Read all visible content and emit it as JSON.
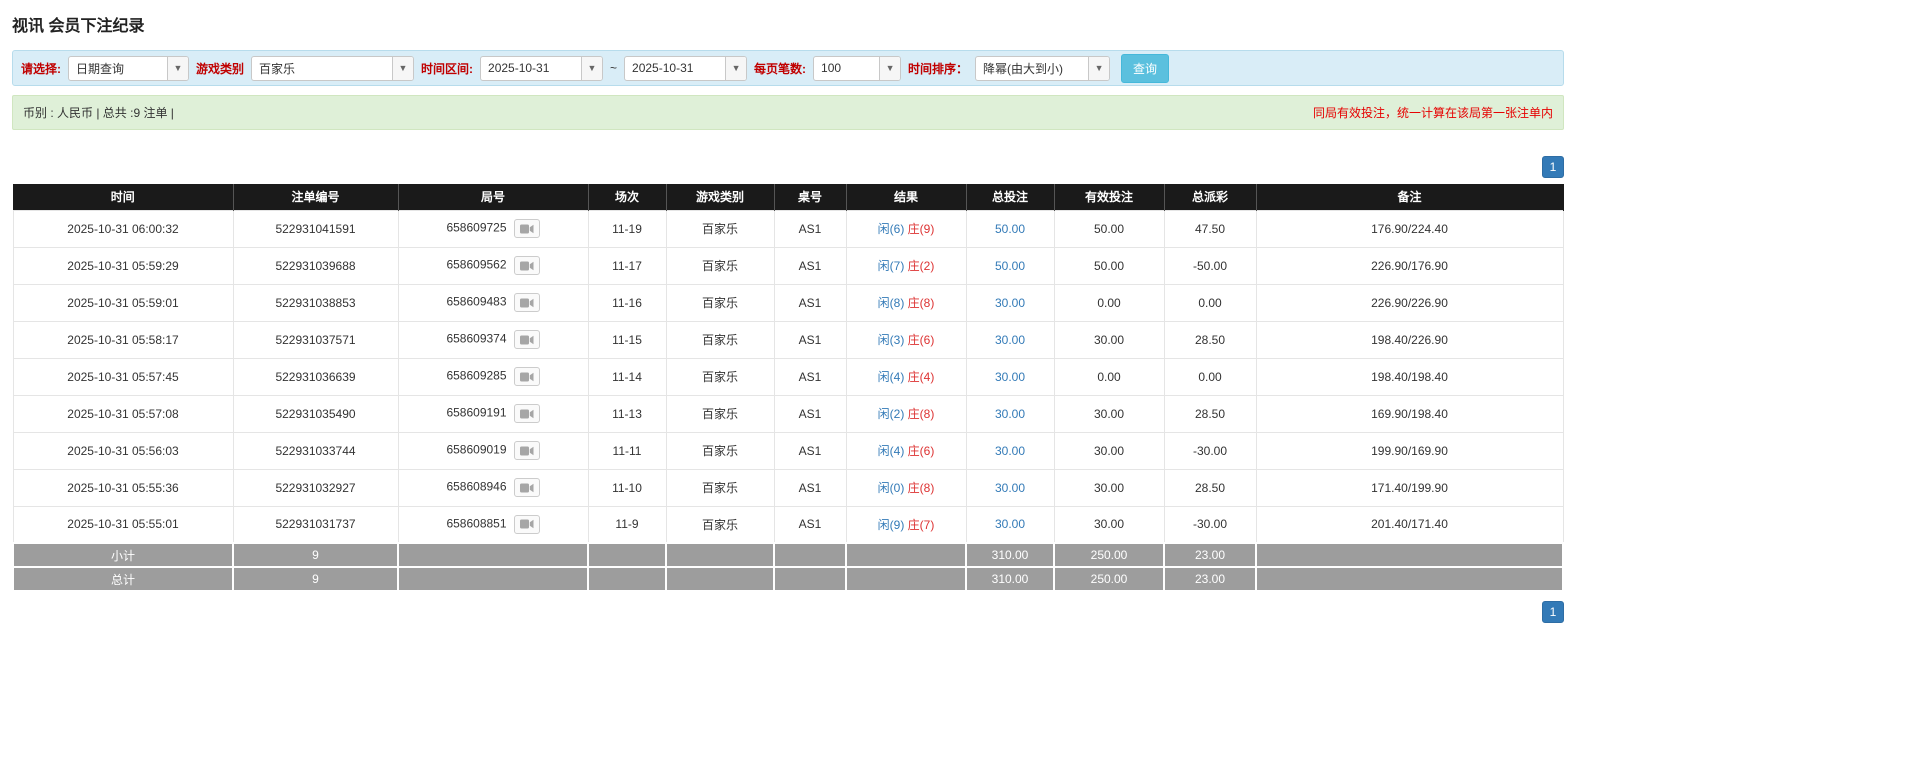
{
  "colors": {
    "label_red": "#c00000",
    "filter_bg": "#d9edf7",
    "filter_border": "#b7dcec",
    "info_bg": "#dff0d8",
    "info_border": "#d0e6c0",
    "notice_red": "#e60000",
    "button_blue": "#5bc0de",
    "button_blue_border": "#46b8da",
    "page_btn_blue": "#337ab7",
    "header_bg": "#1a1a1a",
    "footer_bg": "#9d9d9d",
    "player_blue": "#337ab7",
    "banker_red": "#dd3333",
    "negative_red": "#e60000",
    "link_blue": "#337ab7"
  },
  "page": {
    "title": "视讯 会员下注纪录"
  },
  "filters": {
    "select_label": "请选择:",
    "select_value": "日期查询",
    "game_type_label": "游戏类别",
    "game_type_value": "百家乐",
    "date_range_label": "时间区间:",
    "date_from": "2025-10-31",
    "date_separator": "~",
    "date_to": "2025-10-31",
    "page_size_label": "每页笔数:",
    "page_size_value": "100",
    "sort_label": "时间排序：",
    "sort_value": "降幂(由大到小)",
    "query_button": "查询"
  },
  "info_bar": {
    "summary": "币别 : 人民币 | 总共 :9 注单 |",
    "notice": "同局有效投注，统一计算在该局第一张注单内"
  },
  "pagination": {
    "page": "1"
  },
  "table": {
    "headers": [
      "时间",
      "注单编号",
      "局号",
      "场次",
      "游戏类别",
      "桌号",
      "结果",
      "总投注",
      "有效投注",
      "总派彩",
      "备注"
    ],
    "rows": [
      {
        "time": "2025-10-31 06:00:32",
        "bet_id": "522931041591",
        "round_id": "658609725",
        "session": "11-19",
        "game_type": "百家乐",
        "table_no": "AS1",
        "result_player": "闲(6)",
        "result_banker": "庄(9)",
        "total_bet": "50.00",
        "valid_bet": "50.00",
        "payout": "47.50",
        "remark": "176.90/224.40"
      },
      {
        "time": "2025-10-31 05:59:29",
        "bet_id": "522931039688",
        "round_id": "658609562",
        "session": "11-17",
        "game_type": "百家乐",
        "table_no": "AS1",
        "result_player": "闲(7)",
        "result_banker": "庄(2)",
        "total_bet": "50.00",
        "valid_bet": "50.00",
        "payout": "-50.00",
        "remark": "226.90/176.90"
      },
      {
        "time": "2025-10-31 05:59:01",
        "bet_id": "522931038853",
        "round_id": "658609483",
        "session": "11-16",
        "game_type": "百家乐",
        "table_no": "AS1",
        "result_player": "闲(8)",
        "result_banker": "庄(8)",
        "total_bet": "30.00",
        "valid_bet": "0.00",
        "payout": "0.00",
        "remark": "226.90/226.90"
      },
      {
        "time": "2025-10-31 05:58:17",
        "bet_id": "522931037571",
        "round_id": "658609374",
        "session": "11-15",
        "game_type": "百家乐",
        "table_no": "AS1",
        "result_player": "闲(3)",
        "result_banker": "庄(6)",
        "total_bet": "30.00",
        "valid_bet": "30.00",
        "payout": "28.50",
        "remark": "198.40/226.90"
      },
      {
        "time": "2025-10-31 05:57:45",
        "bet_id": "522931036639",
        "round_id": "658609285",
        "session": "11-14",
        "game_type": "百家乐",
        "table_no": "AS1",
        "result_player": "闲(4)",
        "result_banker": "庄(4)",
        "total_bet": "30.00",
        "valid_bet": "0.00",
        "payout": "0.00",
        "remark": "198.40/198.40"
      },
      {
        "time": "2025-10-31 05:57:08",
        "bet_id": "522931035490",
        "round_id": "658609191",
        "session": "11-13",
        "game_type": "百家乐",
        "table_no": "AS1",
        "result_player": "闲(2)",
        "result_banker": "庄(8)",
        "total_bet": "30.00",
        "valid_bet": "30.00",
        "payout": "28.50",
        "remark": "169.90/198.40"
      },
      {
        "time": "2025-10-31 05:56:03",
        "bet_id": "522931033744",
        "round_id": "658609019",
        "session": "11-11",
        "game_type": "百家乐",
        "table_no": "AS1",
        "result_player": "闲(4)",
        "result_banker": "庄(6)",
        "total_bet": "30.00",
        "valid_bet": "30.00",
        "payout": "-30.00",
        "remark": "199.90/169.90"
      },
      {
        "time": "2025-10-31 05:55:36",
        "bet_id": "522931032927",
        "round_id": "658608946",
        "session": "11-10",
        "game_type": "百家乐",
        "table_no": "AS1",
        "result_player": "闲(0)",
        "result_banker": "庄(8)",
        "total_bet": "30.00",
        "valid_bet": "30.00",
        "payout": "28.50",
        "remark": "171.40/199.90"
      },
      {
        "time": "2025-10-31 05:55:01",
        "bet_id": "522931031737",
        "round_id": "658608851",
        "session": "11-9",
        "game_type": "百家乐",
        "table_no": "AS1",
        "result_player": "闲(9)",
        "result_banker": "庄(7)",
        "total_bet": "30.00",
        "valid_bet": "30.00",
        "payout": "-30.00",
        "remark": "201.40/171.40"
      }
    ],
    "subtotal": {
      "label": "小计",
      "count": "9",
      "total_bet": "310.00",
      "valid_bet": "250.00",
      "payout": "23.00"
    },
    "total": {
      "label": "总计",
      "count": "9",
      "total_bet": "310.00",
      "valid_bet": "250.00",
      "payout": "23.00"
    }
  }
}
